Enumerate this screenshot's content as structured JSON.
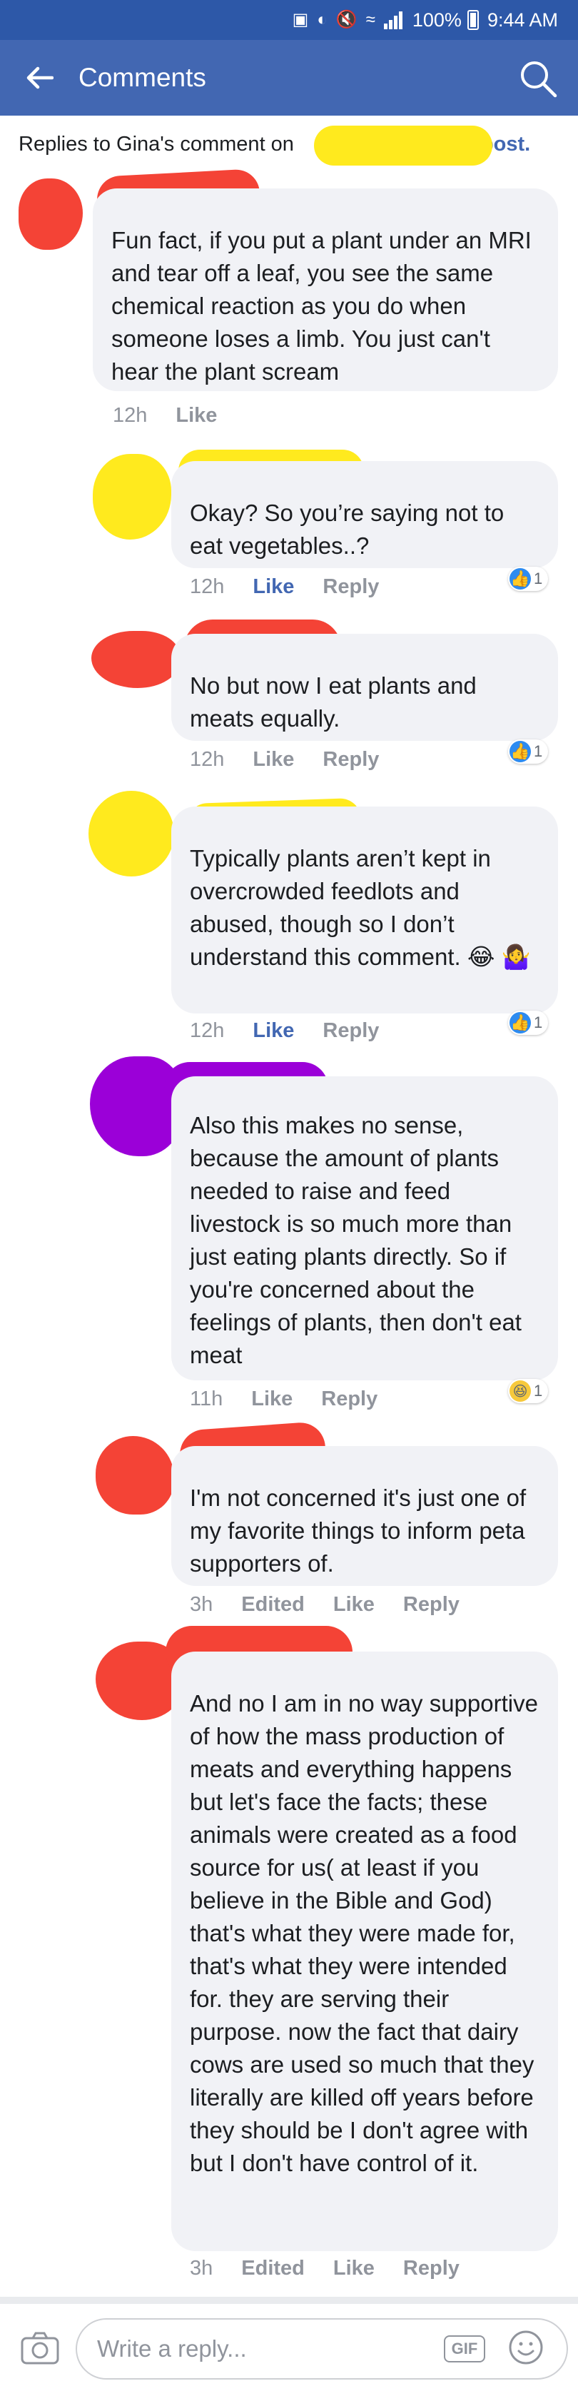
{
  "statusbar": {
    "battery": "100%",
    "time": "9:44 AM"
  },
  "header": {
    "title": "Comments"
  },
  "replies_to": {
    "prefix": "Replies to Gina's comment on",
    "link": "post."
  },
  "colors": {
    "header": "#4267b2",
    "statusbar": "#2d58a8",
    "bubble": "#f1f2f6",
    "accent": "#4267b2",
    "redact_red": "#f44336",
    "redact_yellow": "#ffea1e",
    "redact_purple": "#9b00d8"
  },
  "comments": [
    {
      "text": "Fun fact, if you put a plant under an MRI and tear off a leaf, you see the same chemical reaction as you do when someone loses a limb. You just can't hear the plant scream",
      "time": "12h",
      "like": "Like"
    },
    {
      "text": "Okay? So you’re saying not to eat vegetables..?",
      "time": "12h",
      "like": "Like",
      "reply": "Reply",
      "reaction_count": "1"
    },
    {
      "text": "No but now I eat plants and meats equally.",
      "time": "12h",
      "like": "Like",
      "reply": "Reply",
      "reaction_count": "1"
    },
    {
      "text": "Typically plants aren’t kept in overcrowded feedlots and abused, though so I don’t understand this comment. 😂 🤷‍♀️",
      "time": "12h",
      "like": "Like",
      "reply": "Reply",
      "reaction_count": "1"
    },
    {
      "text": "Also this makes no sense, because the amount of plants needed to raise and feed livestock is so much more than just eating plants directly. So if you're concerned about the feelings of plants, then don't eat meat",
      "time": "11h",
      "like": "Like",
      "reply": "Reply",
      "reaction_count": "1"
    },
    {
      "text": "I'm not concerned it's just one of my favorite things to inform peta supporters of.",
      "time": "3h",
      "edited": "Edited",
      "like": "Like",
      "reply": "Reply"
    },
    {
      "text": "And no I am in no way supportive of how the mass production of meats and everything happens but let's face the facts; these animals were created as a food source for us( at least if you believe in the Bible and God) that's what they were made for, that's what they were intended for. they are serving their purpose. now the fact that dairy cows are used so much that they literally are killed off years before they should be I don't agree with but I don't have control of it.",
      "time": "3h",
      "edited": "Edited",
      "like": "Like",
      "reply": "Reply"
    }
  ],
  "composer": {
    "placeholder": "Write a reply...",
    "gif": "GIF"
  }
}
